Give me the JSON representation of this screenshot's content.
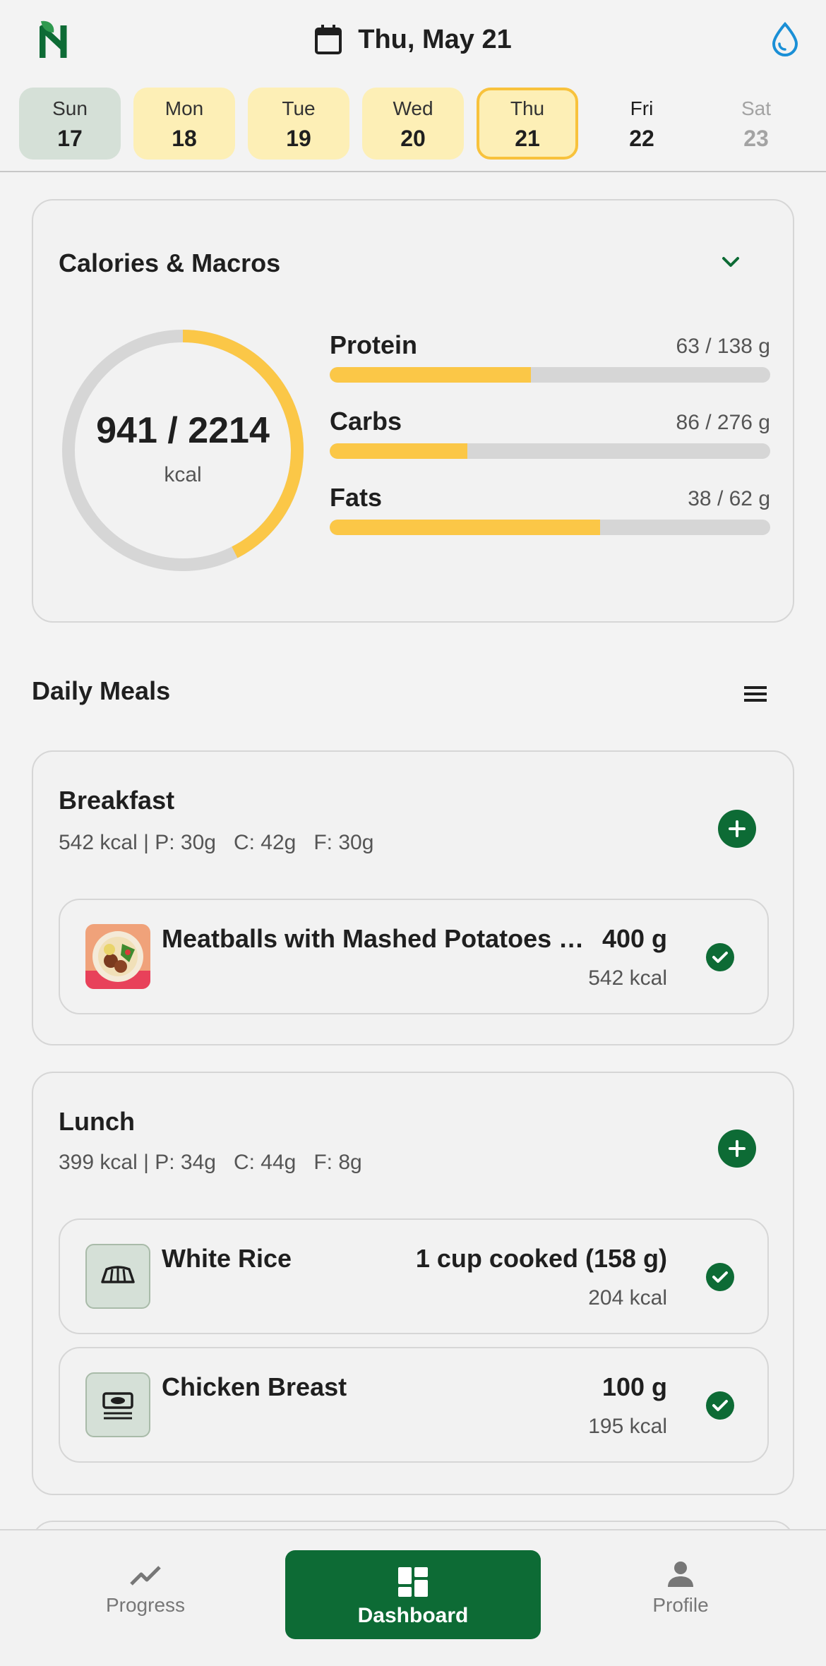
{
  "header": {
    "date": "Thu, May 21",
    "icons": {
      "logo": "app-logo",
      "calendar": "calendar-icon",
      "water": "water-drop-icon"
    }
  },
  "week": [
    {
      "name": "Sun",
      "num": "17",
      "state": "past"
    },
    {
      "name": "Mon",
      "num": "18",
      "state": "logged"
    },
    {
      "name": "Tue",
      "num": "19",
      "state": "logged"
    },
    {
      "name": "Wed",
      "num": "20",
      "state": "logged"
    },
    {
      "name": "Thu",
      "num": "21",
      "state": "selected"
    },
    {
      "name": "Fri",
      "num": "22",
      "state": "future"
    },
    {
      "name": "Sat",
      "num": "23",
      "state": "disabled"
    }
  ],
  "calories": {
    "title": "Calories & Macros",
    "value": "941 / 2214",
    "unit": "kcal",
    "consumed": 941,
    "goal": 2214,
    "macros": [
      {
        "name": "Protein",
        "value": "63 / 138 g",
        "current": 63,
        "goal": 138
      },
      {
        "name": "Carbs",
        "value": "86 / 276 g",
        "current": 86,
        "goal": 276
      },
      {
        "name": "Fats",
        "value": "38 / 62 g",
        "current": 38,
        "goal": 62
      }
    ]
  },
  "meals": {
    "title": "Daily Meals",
    "breakfast": {
      "name": "Breakfast",
      "summary": "542 kcal | P: 30g   C: 42g   F: 30g",
      "items": [
        {
          "name": "Meatballs with Mashed Potatoes …",
          "qty": "400 g",
          "kcal": "542 kcal",
          "thumb": "food-photo"
        }
      ]
    },
    "lunch": {
      "name": "Lunch",
      "summary": "399 kcal | P: 34g   C: 44g   F: 8g",
      "items": [
        {
          "name": "White Rice",
          "qty": "1 cup cooked (158 g)",
          "kcal": "204 kcal",
          "thumb": "bread-icon"
        },
        {
          "name": "Chicken Breast",
          "qty": "100 g",
          "kcal": "195 kcal",
          "thumb": "protein-icon"
        }
      ]
    }
  },
  "nav": {
    "progress": "Progress",
    "dashboard": "Dashboard",
    "profile": "Profile"
  },
  "colors": {
    "brand_green": "#0d6b35",
    "accent_yellow": "#fbc747",
    "logged_day": "#fdefb6",
    "past_day": "#d5e0d7"
  }
}
